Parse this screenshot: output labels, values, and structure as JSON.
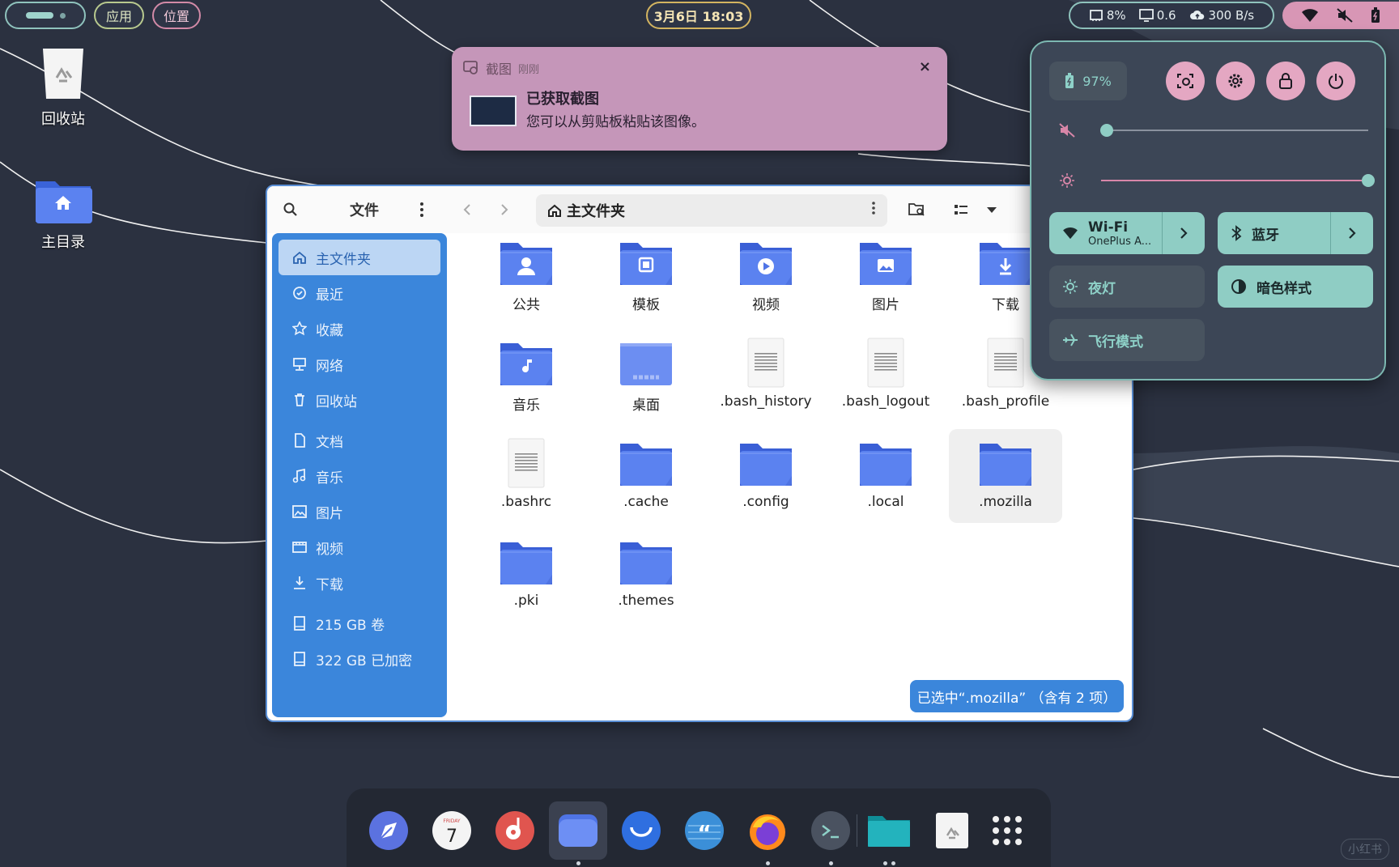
{
  "topbar": {
    "apps_label": "应用",
    "places_label": "位置",
    "clock": "3月6日  18:03",
    "cpu": "8%",
    "load": "0.6",
    "net": "300 B/s"
  },
  "desktop": {
    "trash_label": "回收站",
    "home_label": "主目录"
  },
  "notification": {
    "app": "截图",
    "time": "刚刚",
    "title": "已获取截图",
    "body": "您可以从剪贴板粘贴该图像。",
    "close": "×"
  },
  "file_manager": {
    "title": "文件",
    "path": "主文件夹",
    "status": "已选中“.mozilla” （含有 2 项）",
    "sidebar": [
      {
        "label": "主文件夹",
        "icon": "home-icon",
        "active": true
      },
      {
        "label": "最近",
        "icon": "clock-icon"
      },
      {
        "label": "收藏",
        "icon": "star-icon"
      },
      {
        "label": "网络",
        "icon": "network-icon"
      },
      {
        "label": "回收站",
        "icon": "trash-icon"
      },
      {
        "label": "文档",
        "icon": "document-icon"
      },
      {
        "label": "音乐",
        "icon": "music-icon"
      },
      {
        "label": "图片",
        "icon": "picture-icon"
      },
      {
        "label": "视频",
        "icon": "video-icon"
      },
      {
        "label": "下载",
        "icon": "download-icon"
      },
      {
        "label": "215 GB 卷",
        "icon": "drive-icon"
      },
      {
        "label": "322 GB 已加密",
        "icon": "drive-icon"
      }
    ],
    "files": [
      {
        "name": "公共",
        "type": "folder",
        "glyph": "user"
      },
      {
        "name": "模板",
        "type": "folder",
        "glyph": "template"
      },
      {
        "name": "视频",
        "type": "folder",
        "glyph": "play"
      },
      {
        "name": "图片",
        "type": "folder",
        "glyph": "image"
      },
      {
        "name": "下载",
        "type": "folder",
        "glyph": "download"
      },
      {
        "name": "音乐",
        "type": "folder",
        "glyph": "music"
      },
      {
        "name": "桌面",
        "type": "desktop"
      },
      {
        "name": ".bash_history",
        "type": "text"
      },
      {
        "name": ".bash_logout",
        "type": "text"
      },
      {
        "name": ".bash_profile",
        "type": "text"
      },
      {
        "name": ".bashrc",
        "type": "text"
      },
      {
        "name": ".cache",
        "type": "folder"
      },
      {
        "name": ".config",
        "type": "folder"
      },
      {
        "name": ".local",
        "type": "folder"
      },
      {
        "name": ".mozilla",
        "type": "folder",
        "selected": true
      },
      {
        "name": ".pki",
        "type": "folder"
      },
      {
        "name": ".themes",
        "type": "folder"
      }
    ]
  },
  "quick_settings": {
    "battery": "97%",
    "volume_level": 0.02,
    "brightness_level": 1.0,
    "tiles": {
      "wifi_label": "Wi-Fi",
      "wifi_network": "OnePlus A...",
      "bluetooth_label": "蓝牙",
      "night_light_label": "夜灯",
      "dark_style_label": "暗色样式",
      "airplane_label": "飞行模式"
    }
  },
  "dock": {
    "items": [
      "compass-icon",
      "calendar-icon",
      "music-player-icon",
      "files-icon",
      "mail-icon",
      "quote-app-icon",
      "firefox-icon",
      "terminal-icon",
      "folder-app-icon",
      "trash-app-icon",
      "app-grid-icon"
    ],
    "calendar_day_label": "FRIDAY",
    "calendar_day_number": "7"
  },
  "watermark": "小红书",
  "colors": {
    "accent": "#3b86db",
    "folder": "#4f74e6",
    "qs_teal": "#8fcdc4",
    "qs_pink": "#e4a7c2",
    "notif_bg": "#c596b9"
  }
}
